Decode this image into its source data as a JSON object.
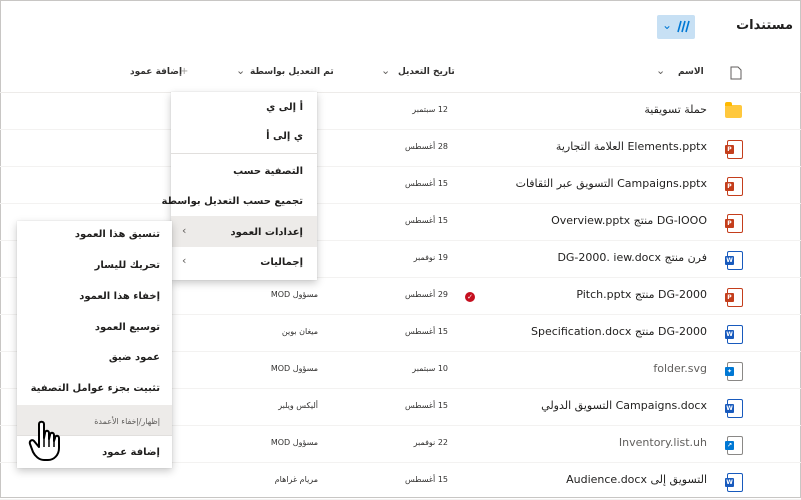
{
  "title": "مستندات",
  "columns": {
    "name": "الاسم",
    "modified": "تاريخ التعديل",
    "modified_by": "تم التعديل بواسطة",
    "add_column": "إضافة عمود",
    "add_column_plus": "+"
  },
  "rows": [
    {
      "name": "حملة تسويقية",
      "date": "12 سبتمبر",
      "modified_by": "",
      "type": "folder"
    },
    {
      "name": "Elements.pptx العلامة التجارية",
      "date": "28 أغسطس",
      "modified_by": "",
      "type": "pptx"
    },
    {
      "name": "Campaigns.pptx التسويق عبر الثقافات",
      "date": "15 أغسطس",
      "modified_by": "",
      "type": "pptx"
    },
    {
      "name": "DG-IOOO منتج Overview.pptx",
      "date": "15 أغسطس",
      "modified_by": "",
      "type": "pptx"
    },
    {
      "name": "فرن منتج DG-2000. iew.docx",
      "date": "19 نوفمبر",
      "modified_by": "",
      "type": "docx"
    },
    {
      "name": "DG-2000 منتج Pitch.pptx",
      "date": "29 أغسطس",
      "modified_by": "مسؤول MOD",
      "type": "pptx",
      "alert": "✓"
    },
    {
      "name": "DG-2000 منتج Specification.docx",
      "date": "15 أغسطس",
      "modified_by": "ميغان بوين",
      "type": "docx"
    },
    {
      "name": "folder.svg",
      "date": "10 سبتمبر",
      "modified_by": "مسؤول MOD",
      "type": "svg"
    },
    {
      "name": "Campaigns.docx التسويق الدولي",
      "date": "15 أغسطس",
      "modified_by": "أليكس ويلبر",
      "type": "docx"
    },
    {
      "name": "Inventory.list.uh",
      "date": "22 نوفمبر",
      "modified_by": "مسؤول MOD",
      "type": "url"
    },
    {
      "name": "التسويق إلى Audience.docx",
      "date": "15 أغسطس",
      "modified_by": "مريام غراهام",
      "type": "docx"
    }
  ],
  "sort_menu": {
    "a_to_z": "أ إلى ي",
    "z_to_a": "ي إلى أ",
    "filter_by": "التصفية حسب",
    "group_by": "تجميع حسب التعديل بواسطة",
    "column_settings": "إعدادات العمود",
    "totals": "إجماليات"
  },
  "column_menu": {
    "format_column": "تنسيق هذا العمود",
    "move_left": "تحريك لليسار",
    "hide_column": "إخفاء هذا العمود",
    "widen_column": "توسيع العمود",
    "narrow_column": "عمود ضيق",
    "pin_filters": "تثبيت بجزء عوامل التصفية",
    "show_hide_columns": "إظهار/إخفاء الأعمدة",
    "add_column": "إضافة عمود"
  },
  "icons": {
    "file_type": "file-icon",
    "pointer": "hand-cursor-icon"
  },
  "colors": {
    "accent": "#0078d4",
    "view_button": "#c7e0f4",
    "pptx": "#c43e1c",
    "docx": "#185abd",
    "folder": "#ffc83d",
    "alert": "#c50f1f"
  }
}
